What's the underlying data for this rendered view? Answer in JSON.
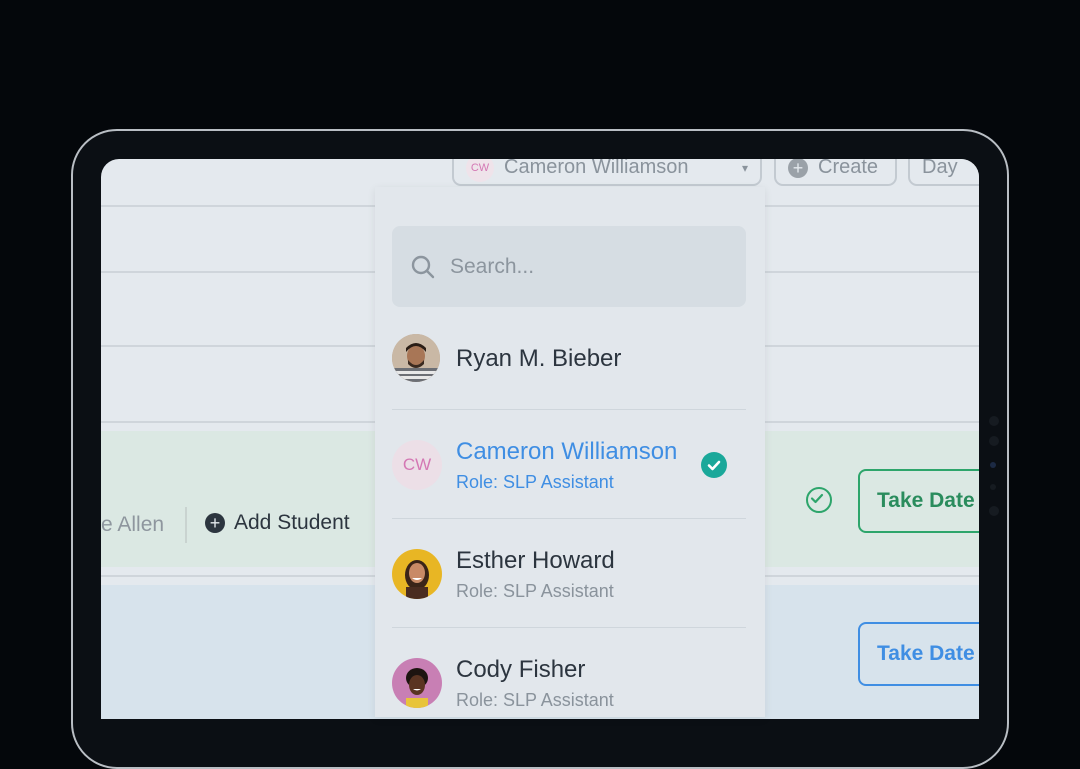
{
  "header": {
    "user_selector_initials": "CW",
    "user_selector_name": "Cameron Williamson",
    "create_label": "Create",
    "view_label": "Day"
  },
  "search": {
    "placeholder": "Search..."
  },
  "users": [
    {
      "name": "Ryan M. Bieber",
      "role": "",
      "avatar": "photo-man-beard",
      "selected": false
    },
    {
      "name": "Cameron Williamson",
      "role": "Role: SLP Assistant",
      "initials": "CW",
      "selected": true
    },
    {
      "name": "Esther Howard",
      "role": "Role: SLP Assistant",
      "avatar": "photo-woman-yellow",
      "selected": false
    },
    {
      "name": "Cody Fisher",
      "role": "Role: SLP Assistant",
      "avatar": "photo-person-pink",
      "selected": false
    }
  ],
  "session_rows": [
    {
      "student_name_partial": "e Allen",
      "add_student_label": "Add Student",
      "take_data_label": "Take Date",
      "status": "completed",
      "color": "#2da56b"
    },
    {
      "take_data_label": "Take Date",
      "color": "#3f8ee3"
    }
  ],
  "colors": {
    "accent_blue": "#3f8ee3",
    "accent_green": "#2da56b",
    "check_teal": "#1aa89a",
    "initials_pink": "#d478b4"
  }
}
